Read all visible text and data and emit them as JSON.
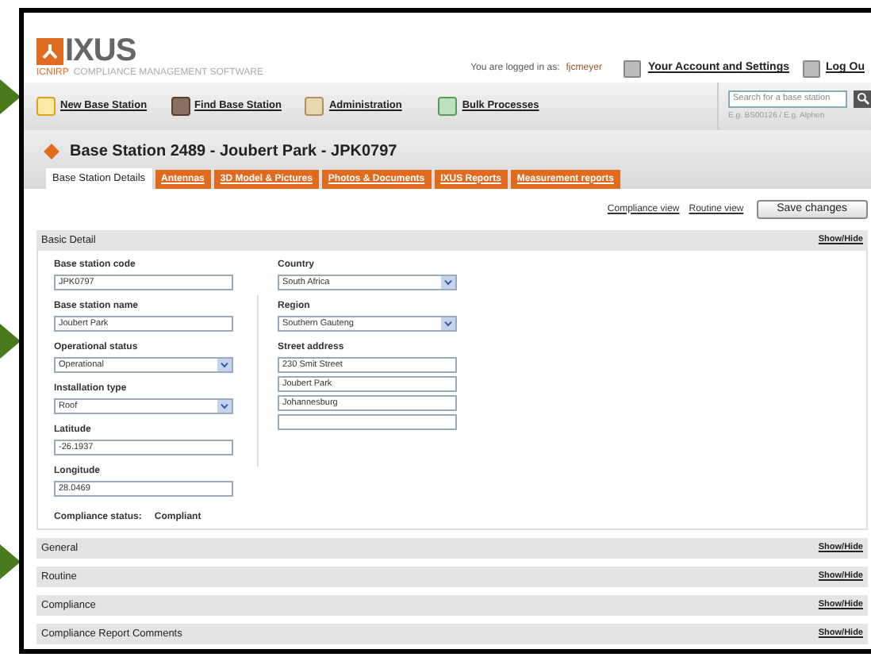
{
  "logo": {
    "name": "IXUS",
    "tag_1": "ICNIRP",
    "tag_2": "COMPLIANCE MANAGEMENT SOFTWARE"
  },
  "login": {
    "label": "You are logged in as:",
    "user": "fjcmeyer"
  },
  "account_links": [
    "Your Account and Settings",
    "Log Ou"
  ],
  "nav": [
    "New Base Station",
    "Find Base Station",
    "Administration",
    "Bulk Processes"
  ],
  "search": {
    "placeholder": "Search for a base station",
    "hint": "E.g. BS00126 / E.g. Alphen"
  },
  "page_title": "Base Station 2489 - Joubert Park - JPK0797",
  "tabs": [
    {
      "label": "Base Station Details",
      "selected": true
    },
    {
      "label": "Antennas",
      "selected": false
    },
    {
      "label": "3D Model & Pictures",
      "selected": false
    },
    {
      "label": "Photos & Documents",
      "selected": false
    },
    {
      "label": "IXUS Reports",
      "selected": false
    },
    {
      "label": "Measurement reports",
      "selected": false
    }
  ],
  "view_links": [
    "Compliance view",
    "Routine view"
  ],
  "save_button": "Save changes",
  "basic_detail": {
    "title": "Basic Detail",
    "toggle": "Show/Hide",
    "left_fields": [
      {
        "label": "Base station code",
        "kind": "text",
        "values": [
          "JPK0797"
        ]
      },
      {
        "label": "Base station name",
        "kind": "text",
        "values": [
          "Joubert Park"
        ]
      },
      {
        "label": "Operational status",
        "kind": "select",
        "values": [
          "Operational"
        ]
      },
      {
        "label": "Installation type",
        "kind": "select",
        "values": [
          "Roof"
        ]
      },
      {
        "label": "Latitude",
        "kind": "text",
        "values": [
          "-26.1937"
        ]
      },
      {
        "label": "Longitude",
        "kind": "text",
        "values": [
          "28.0469"
        ]
      }
    ],
    "right_fields": [
      {
        "label": "Country",
        "kind": "select",
        "values": [
          "South Africa"
        ]
      },
      {
        "label": "Region",
        "kind": "select",
        "values": [
          "Southern Gauteng"
        ]
      },
      {
        "label": "Street address",
        "kind": "text",
        "values": [
          "230 Smit Street",
          "Joubert Park",
          "Johannesburg"
        ],
        "empty_line": true
      }
    ],
    "compliance_label": "Compliance status:",
    "compliance_value": "Compliant"
  },
  "sections": [
    {
      "title": "General",
      "toggle": "Show/Hide"
    },
    {
      "title": "Routine",
      "toggle": "Show/Hide"
    },
    {
      "title": "Compliance",
      "toggle": "Show/Hide"
    },
    {
      "title": "Compliance Report Comments",
      "toggle": "Show/Hide"
    }
  ]
}
